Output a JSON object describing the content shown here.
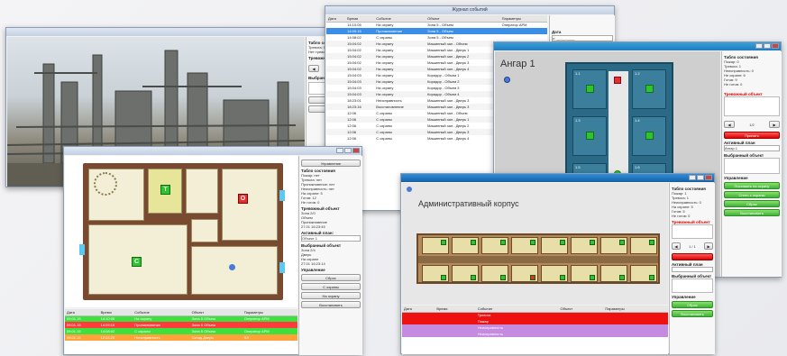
{
  "win_industrial": {
    "side": {
      "title": "Табло состояния",
      "line1": "Тревога: 0",
      "line2": "Нет тревоги",
      "alarm_title": "Тревожные зоны",
      "pager": "1",
      "selected_title": "Выбранная зона"
    }
  },
  "win_events": {
    "title": "Журнал событий",
    "columns": [
      "Дата",
      "Время",
      "Событие",
      "Объект",
      "Параметры"
    ],
    "rows": [
      {
        "time": "14:10:05",
        "event": "На охрану",
        "object": "Зона 5 - Объем",
        "param": "Оператор АРМ"
      },
      {
        "time": "14:09:15",
        "event": "Проникновение",
        "object": "Зона 5 - Объем",
        "param": ""
      },
      {
        "time": "14:08:02",
        "event": "С охраны",
        "object": "Зона 5 - Объем",
        "param": ""
      },
      {
        "time": "15:04:02",
        "event": "На охрану",
        "object": "Машинный зал - Объем",
        "param": ""
      },
      {
        "time": "15:04:02",
        "event": "На охрану",
        "object": "Машинный зал - Дверь 1",
        "param": ""
      },
      {
        "time": "15:04:02",
        "event": "На охрану",
        "object": "Машинный зал - Дверь 2",
        "param": ""
      },
      {
        "time": "15:04:02",
        "event": "На охрану",
        "object": "Машинный зал - Дверь 3",
        "param": ""
      },
      {
        "time": "15:04:02",
        "event": "На охрану",
        "object": "Машинный зал - Дверь 4",
        "param": ""
      },
      {
        "time": "15:04:03",
        "event": "На охрану",
        "object": "Коридор - Объем 1",
        "param": ""
      },
      {
        "time": "15:04:03",
        "event": "На охрану",
        "object": "Коридор - Объем 2",
        "param": ""
      },
      {
        "time": "15:04:03",
        "event": "На охрану",
        "object": "Коридор - Объем 3",
        "param": ""
      },
      {
        "time": "15:04:03",
        "event": "На охрану",
        "object": "Коридор - Объем 4",
        "param": ""
      },
      {
        "time": "18:23:01",
        "event": "Неисправность",
        "object": "Машинный зал - Дверь 3",
        "param": ""
      },
      {
        "time": "18:23:16",
        "event": "Восстановление",
        "object": "Машинный зал - Дверь 3",
        "param": ""
      },
      {
        "time": "12:06",
        "event": "С охраны",
        "object": "Машинный зал - Объем",
        "param": ""
      },
      {
        "time": "12:06",
        "event": "С охраны",
        "object": "Машинный зал - Дверь 1",
        "param": ""
      },
      {
        "time": "12:06",
        "event": "С охраны",
        "object": "Машинный зал - Дверь 2",
        "param": ""
      },
      {
        "time": "12:06",
        "event": "С охраны",
        "object": "Машинный зал - Дверь 3",
        "param": ""
      },
      {
        "time": "12:06",
        "event": "С охраны",
        "object": "Машинный зал - Дверь 4",
        "param": ""
      }
    ],
    "filter": {
      "label": "Дата",
      "from": "с: __.__.____",
      "to": "по: __.__.____"
    }
  },
  "win_hangar": {
    "plan_title": "Ангар 1",
    "side": {
      "title": "Табло состояния",
      "lines": [
        "Пожар: 0",
        "Тревога: 1",
        "Неисправность: 0",
        "Не охране: 6",
        "Готов: 9",
        "Не готов: 0"
      ],
      "alarm_title": "Тревожный объект",
      "pager": "1/2",
      "accept_button": "Принять",
      "active_plan_label": "Активный план",
      "active_plan_value": "Ангар 1",
      "selected_title": "Выбранный объект",
      "controls_title": "Управление",
      "buttons": [
        "Поставить на охрану",
        "Снять с охраны",
        "Сброс",
        "Восстановить"
      ]
    },
    "cells": [
      "1.1",
      "1.2",
      "1.3",
      "1.4",
      "1.5",
      "1.6",
      "1.7",
      "1.8"
    ]
  },
  "win_house": {
    "side": {
      "top_button": "Управление",
      "title": "Табло состояния",
      "lines": [
        "Пожар: нет",
        "Тревога: нет",
        "Проникновение: нет",
        "Неисправность: нет",
        "На охране: 5",
        "Готов: 12",
        "Не готов: 0"
      ],
      "alarm_title": "Тревожный объект",
      "alarm_lines": [
        "Зона 2/0",
        "Объем",
        "Проникновение",
        "27.01 16:23:45"
      ],
      "active_plan_label": "Активный план:",
      "active_plan_value": "Объект 1",
      "selected_title": "Выбранный объект",
      "selected_lines": [
        "Зона 2/4",
        "Дверь",
        "На охране",
        "27.01 16:23:14"
      ],
      "controls_title": "Управление",
      "buttons": [
        "Сброс",
        "С охраны",
        "На охрану",
        "Восстановить"
      ]
    },
    "markers": {
      "t": "T",
      "o": "O",
      "c": "C"
    },
    "columns": [
      "Дата",
      "Время",
      "Событие",
      "Объект",
      "Параметры"
    ],
    "rows": [
      {
        "date": "09.01.15",
        "time": "14:10:05",
        "event": "На охрану",
        "object": "Зона 5 Объем",
        "param": "Оператор АРМ",
        "color": "#3ee03e"
      },
      {
        "date": "09.01.15",
        "time": "14:09:15",
        "event": "Проникновение",
        "object": "Зона 5 Объем",
        "param": "",
        "color": "#ff3b3b"
      },
      {
        "date": "09.01.15",
        "time": "14:08:02",
        "event": "С охраны",
        "object": "Зона 5 Объем",
        "param": "Оператор АРМ",
        "color": "#3ee03e"
      },
      {
        "date": "09.01.15",
        "time": "12:03:20",
        "event": "Неисправность",
        "object": "Склад Двери",
        "param": "ВЛ",
        "color": "#ffa23a"
      }
    ]
  },
  "win_admin": {
    "plan_title": "Административный корпус",
    "side": {
      "title": "Табло состояния",
      "lines": [
        "Пожар: 1",
        "Тревога: 1",
        "Неисправность: 0",
        "На охране: 5",
        "Готов: 5",
        "Не готов: 0"
      ],
      "alarm_title": "Тревожный объект",
      "pager": "1 / 1",
      "active_plan_label": "Активный план",
      "selected_title": "Выбранный объект",
      "controls_title": "Управление",
      "buttons": [
        "Сброс",
        "Восстановить"
      ]
    },
    "columns": [
      "Дата",
      "Время",
      "Событие",
      "Объект",
      "Параметры"
    ],
    "rows": [
      {
        "event": "Тревога",
        "color": "#e11"
      },
      {
        "event": "Пожар",
        "color": "#e11"
      },
      {
        "event": "Неисправность",
        "color": "#c48be0"
      },
      {
        "event": "Неисправность",
        "color": "#c48be0"
      },
      {
        "event": "",
        "color": "#ffffff"
      }
    ]
  }
}
